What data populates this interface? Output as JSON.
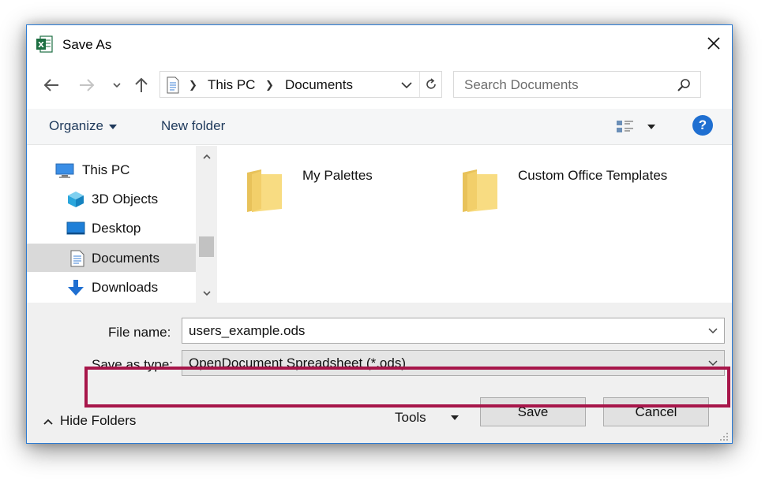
{
  "window": {
    "title": "Save As",
    "app_icon": "excel-icon",
    "close_icon": "close-icon"
  },
  "nav": {
    "back_icon": "back-arrow-icon",
    "forward_icon": "forward-arrow-icon",
    "recent_icon": "chevron-down-icon",
    "up_icon": "up-arrow-icon"
  },
  "address": {
    "crumbs": [
      "This PC",
      "Documents"
    ],
    "refresh_icon": "refresh-icon"
  },
  "search": {
    "placeholder": "Search Documents",
    "icon": "search-icon"
  },
  "toolbar": {
    "organize": "Organize",
    "new_folder": "New folder",
    "view_icon": "view-options-icon",
    "help": "?"
  },
  "sidebar": {
    "items": [
      {
        "label": "This PC",
        "icon": "computer-icon",
        "selected": false
      },
      {
        "label": "3D Objects",
        "icon": "cube-icon",
        "selected": false
      },
      {
        "label": "Desktop",
        "icon": "desktop-icon",
        "selected": false
      },
      {
        "label": "Documents",
        "icon": "document-icon",
        "selected": true
      },
      {
        "label": "Downloads",
        "icon": "download-icon",
        "selected": false
      }
    ]
  },
  "content": {
    "folders": [
      {
        "label": "My Palettes",
        "icon": "folder-icon"
      },
      {
        "label": "Custom Office Templates",
        "icon": "folder-icon"
      }
    ]
  },
  "form": {
    "file_name_label": "File name:",
    "file_name_value": "users_example.ods",
    "save_type_label": "Save as type:",
    "save_type_value": "OpenDocument Spreadsheet (*.ods)"
  },
  "footer": {
    "hide_folders": "Hide Folders",
    "tools": "Tools",
    "save": "Save",
    "cancel": "Cancel"
  },
  "colors": {
    "highlight": "#a7164a",
    "accent": "#1f6fd1",
    "folder": "#f5d77a"
  }
}
